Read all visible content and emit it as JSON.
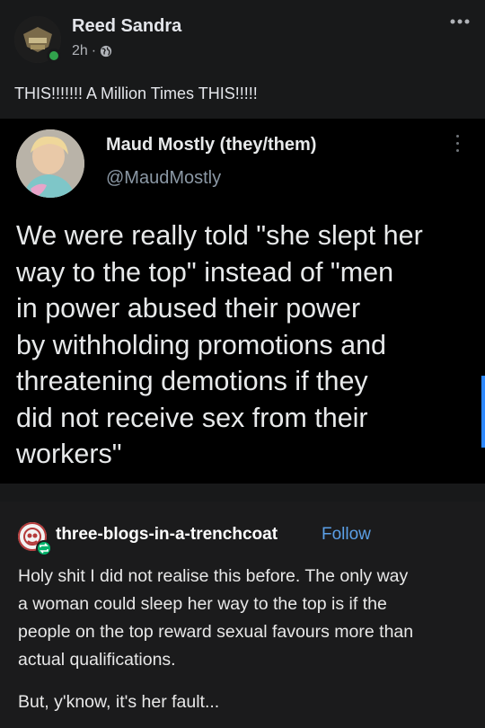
{
  "post": {
    "author": "Reed Sandra",
    "time": "2h",
    "separator": "·",
    "text": "THIS!!!!!!! A Million Times THIS!!!!!",
    "more_icon": "more-horizontal-icon",
    "privacy_icon": "globe-icon"
  },
  "tweet": {
    "name": "Maud Mostly (they/them)",
    "handle": "@MaudMostly",
    "lines": [
      "We were really told \"she slept her",
      "way to the top\" instead of \"men",
      "in power abused their power",
      "by withholding promotions and",
      "threatening demotions if they",
      "did not receive sex from their",
      "workers\""
    ]
  },
  "tumblr": {
    "username": "three-blogs-in-a-trenchcoat",
    "follow_label": "Follow",
    "paragraph1_lines": [
      "Holy shit I did not realise this before. The only way",
      "a woman could sleep her way to the top is if the",
      "people on the top reward sexual favours more than",
      "actual qualifications."
    ],
    "paragraph2": "But, y'know, it's her fault..."
  },
  "colors": {
    "background": "#18191a",
    "tweet_background": "#000000",
    "follow": "#5b9fe6",
    "online": "#31a24c",
    "reblog": "#00b36b"
  }
}
